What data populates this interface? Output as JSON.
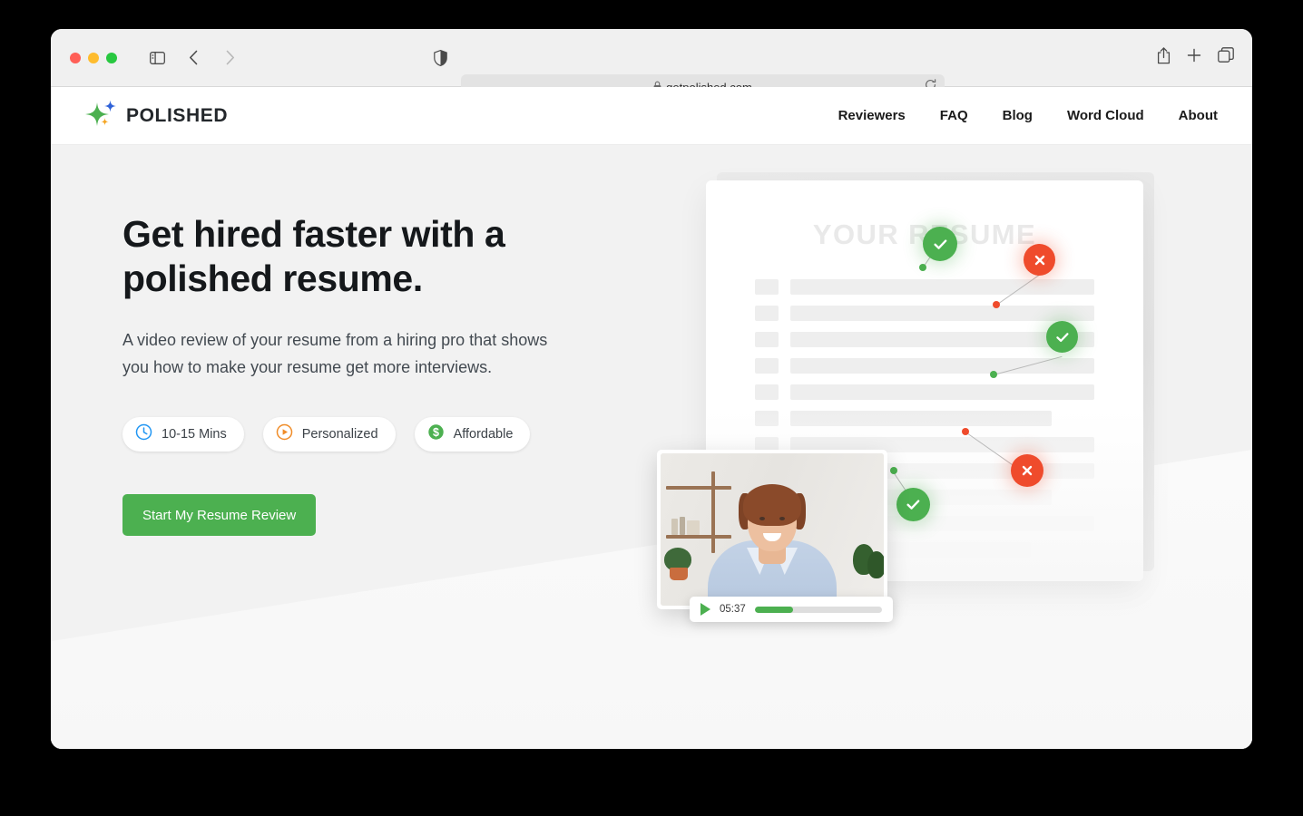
{
  "browser": {
    "traffic_lights": [
      "close",
      "minimize",
      "maximize"
    ],
    "sidebar_icon": "sidebar-icon",
    "back_icon": "chevron-left-icon",
    "forward_icon": "chevron-right-icon",
    "shield_icon": "shield-icon",
    "lock_icon": "lock-icon",
    "url": "getpolished.com",
    "reload_icon": "reload-icon",
    "share_icon": "share-icon",
    "new_tab_icon": "plus-icon",
    "tab_overview_icon": "tab-overview-icon"
  },
  "site_header": {
    "logo_text": "POLISHED",
    "logo_icon": "sparkle-logo-icon",
    "nav": [
      {
        "label": "Reviewers"
      },
      {
        "label": "FAQ"
      },
      {
        "label": "Blog"
      },
      {
        "label": "Word Cloud"
      },
      {
        "label": "About"
      }
    ]
  },
  "hero": {
    "title_line1": "Get hired faster with a",
    "title_line2": "polished resume.",
    "subtitle": "A video review of your resume from a hiring pro that shows you how to make your resume get more interviews.",
    "pills": [
      {
        "label": "10-15 Mins",
        "icon": "clock-icon",
        "color": "#2196f3"
      },
      {
        "label": "Personalized",
        "icon": "play-circle-icon",
        "color": "#f08c28"
      },
      {
        "label": "Affordable",
        "icon": "dollar-circle-icon",
        "color": "#4cb050"
      }
    ],
    "cta_label": "Start My Resume Review",
    "cta_color": "#4cb050"
  },
  "illustration": {
    "resume_title": "YOUR RESUME",
    "video": {
      "time": "05:37",
      "progress_percent": 30,
      "play_icon": "play-icon",
      "accent_color": "#4cb050"
    },
    "markers": [
      {
        "type": "good",
        "icon": "check-icon"
      },
      {
        "type": "bad",
        "icon": "x-icon"
      },
      {
        "type": "good",
        "icon": "check-icon"
      },
      {
        "type": "bad",
        "icon": "x-icon"
      },
      {
        "type": "bad",
        "icon": "x-icon"
      },
      {
        "type": "good",
        "icon": "check-icon"
      }
    ],
    "marker_good_color": "#4cb050",
    "marker_bad_color": "#ef4b2c"
  }
}
